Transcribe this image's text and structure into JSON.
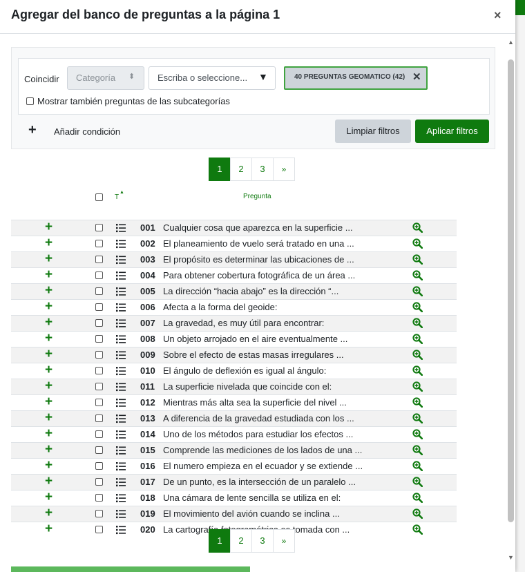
{
  "dialog": {
    "title": "Agregar del banco de preguntas a la página 1",
    "close_icon": "×"
  },
  "filter": {
    "match_label": "Coincidir",
    "category_select": "Categoría",
    "combo_placeholder": "Escriba o seleccione...",
    "chip_label": "40 PREGUNTAS GEOMATICO (42)",
    "subcategories_label": "Mostrar también preguntas de las subcategorías",
    "add_condition": "Añadir condición",
    "clear_button": "Limpiar filtros",
    "apply_button": "Aplicar filtros"
  },
  "pagination": {
    "pages": [
      "1",
      "2",
      "3"
    ],
    "next": "»",
    "active": "1"
  },
  "table": {
    "col_type": "T",
    "col_question": "Pregunta",
    "rows": [
      {
        "num": "001",
        "text": "Cualquier cosa que aparezca en la superficie ..."
      },
      {
        "num": "002",
        "text": "El planeamiento de vuelo será tratado en una ..."
      },
      {
        "num": "003",
        "text": "El propósito es determinar las ubicaciones de ..."
      },
      {
        "num": "004",
        "text": "Para obtener cobertura fotográfica de un área ..."
      },
      {
        "num": "005",
        "text": "La dirección “hacia abajo” es la dirección “..."
      },
      {
        "num": "006",
        "text": "Afecta a la forma del geoide:"
      },
      {
        "num": "007",
        "text": "La gravedad, es muy útil para encontrar:"
      },
      {
        "num": "008",
        "text": "Un objeto arrojado en el aire eventualmente ..."
      },
      {
        "num": "009",
        "text": "Sobre el efecto de estas masas irregulares ..."
      },
      {
        "num": "010",
        "text": "El ángulo de deflexión es igual al ángulo:"
      },
      {
        "num": "011",
        "text": "La superficie nivelada que coincide con el:"
      },
      {
        "num": "012",
        "text": "Mientras más alta sea la superficie del nivel ..."
      },
      {
        "num": "013",
        "text": "A diferencia de la gravedad estudiada con los ..."
      },
      {
        "num": "014",
        "text": "Uno de los métodos para estudiar los efectos ..."
      },
      {
        "num": "015",
        "text": "Comprende las mediciones de los lados de una ..."
      },
      {
        "num": "016",
        "text": "El numero empieza en el ecuador y se extiende ..."
      },
      {
        "num": "017",
        "text": "De un punto, es la intersección de un paralelo ..."
      },
      {
        "num": "018",
        "text": "Una cámara de lente sencilla se utiliza en el:"
      },
      {
        "num": "019",
        "text": "El movimiento del avión cuando se inclina ..."
      },
      {
        "num": "020",
        "text": "La cartografía fotogramétrica es tomada con ..."
      }
    ]
  },
  "colors": {
    "accent": "#0f7a0f",
    "chip_border": "#3fa33f"
  },
  "icons": {
    "add": "plus-icon",
    "type": "multichoice-list-icon",
    "preview": "zoom-in-icon"
  }
}
